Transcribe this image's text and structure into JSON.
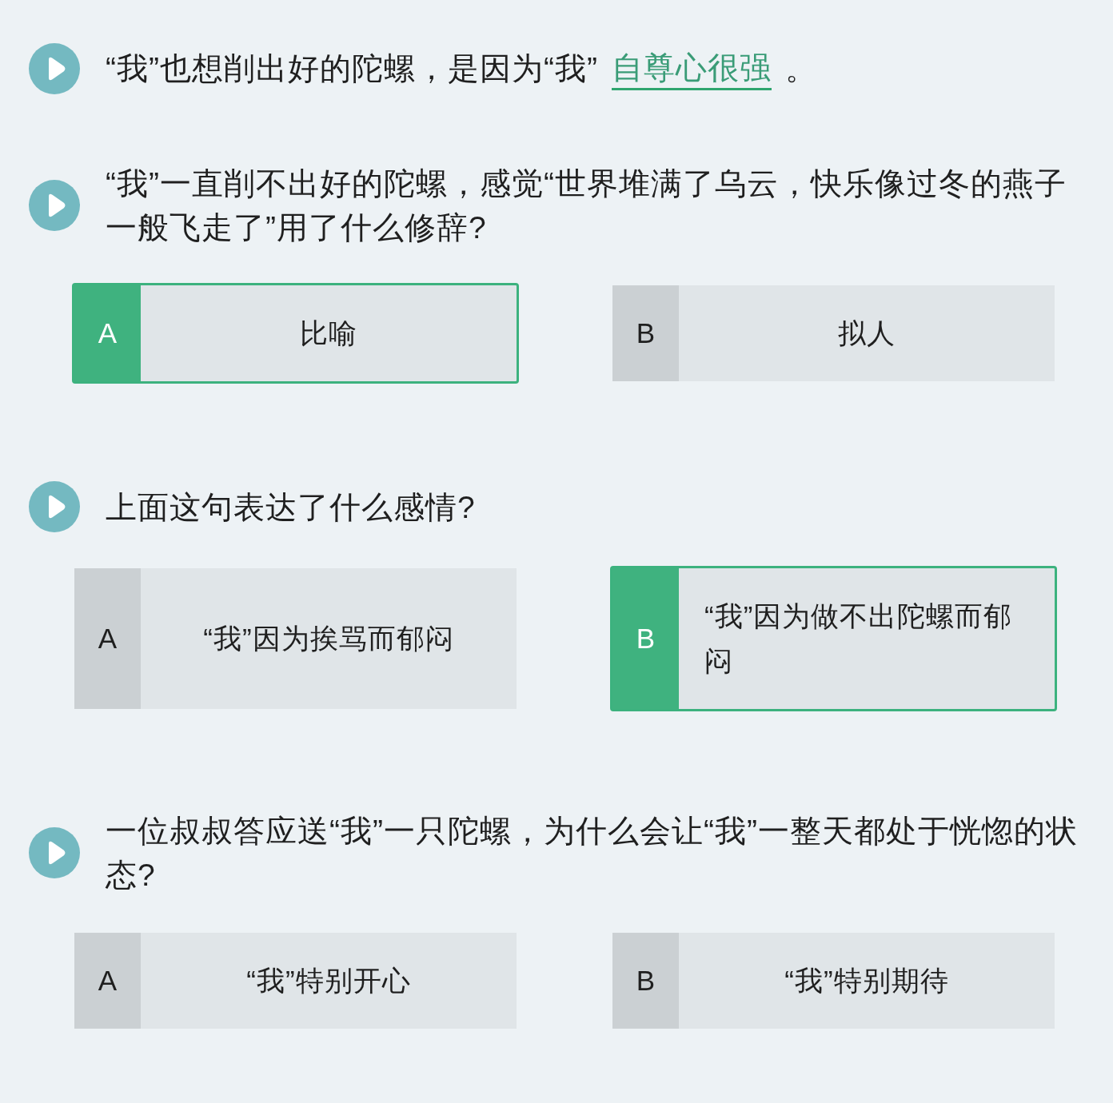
{
  "questions": [
    {
      "kind": "fill_in",
      "prompt": "“我”也想削出好的陀螺，是因为“我”",
      "answer": "自尊心很强",
      "ending": "。"
    },
    {
      "kind": "choice",
      "prompt": "“我”一直削不出好的陀螺，感觉“世界堆满了乌云，快乐像过冬的燕子一般飞走了”用了什么修辞?",
      "options": [
        {
          "letter": "A",
          "text": "比喻",
          "selected": true
        },
        {
          "letter": "B",
          "text": "拟人",
          "selected": false
        }
      ]
    },
    {
      "kind": "choice",
      "prompt": "上面这句表达了什么感情?",
      "options": [
        {
          "letter": "A",
          "text": "“我”因为挨骂而郁闷",
          "selected": false
        },
        {
          "letter": "B",
          "text": "“我”因为做不出陀螺而郁闷",
          "selected": true
        }
      ]
    },
    {
      "kind": "choice",
      "prompt": "一位叔叔答应送“我”一只陀螺，为什么会让“我”一整天都处于恍惚的状态?",
      "options": [
        {
          "letter": "A",
          "text": "“我”特别开心",
          "selected": false
        },
        {
          "letter": "B",
          "text": "“我”特别期待",
          "selected": false
        }
      ]
    }
  ]
}
